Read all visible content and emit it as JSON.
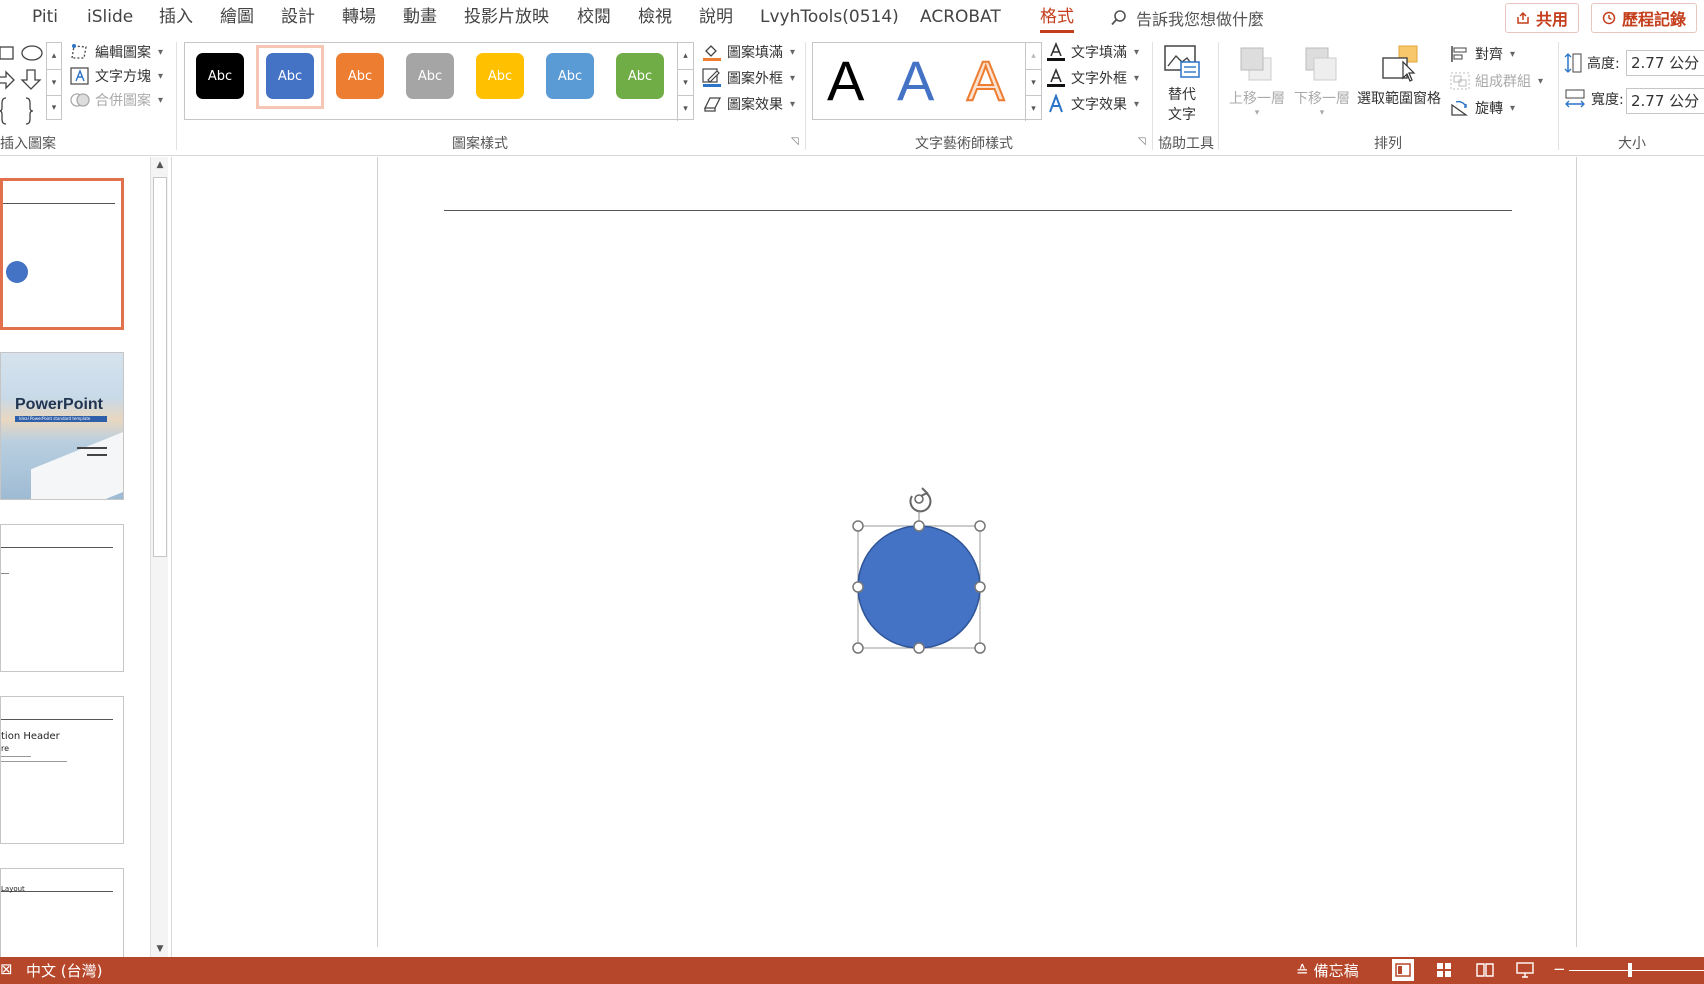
{
  "tabs": [
    {
      "label": "Piti"
    },
    {
      "label": "iSlide"
    },
    {
      "label": "插入"
    },
    {
      "label": "繪圖"
    },
    {
      "label": "設計"
    },
    {
      "label": "轉場"
    },
    {
      "label": "動畫"
    },
    {
      "label": "投影片放映"
    },
    {
      "label": "校閱"
    },
    {
      "label": "檢視"
    },
    {
      "label": "說明"
    },
    {
      "label": "LvyhTools(0514)"
    },
    {
      "label": "ACROBAT"
    },
    {
      "label": "格式"
    }
  ],
  "tab_partial": "",
  "tell_me": "告訴我您想做什麼",
  "share_button": "共用",
  "history_button": "歷程記錄",
  "ribbon": {
    "insert_shapes": {
      "label": "插入圖案",
      "edit_shape": "編輯圖案",
      "text_box": "文字方塊",
      "merge_shapes": "合併圖案"
    },
    "shape_styles": {
      "label": "圖案樣式",
      "swatches": [
        {
          "text": "Abc",
          "color": "#000000",
          "text_color": "#ffffff"
        },
        {
          "text": "Abc",
          "color": "#4472c4",
          "text_color": "#ffffff"
        },
        {
          "text": "Abc",
          "color": "#ed7d31",
          "text_color": "#ffffff"
        },
        {
          "text": "Abc",
          "color": "#a5a5a5",
          "text_color": "#ffffff"
        },
        {
          "text": "Abc",
          "color": "#ffc000",
          "text_color": "#ffffff"
        },
        {
          "text": "Abc",
          "color": "#5b9bd5",
          "text_color": "#ffffff"
        },
        {
          "text": "Abc",
          "color": "#70ad47",
          "text_color": "#ffffff"
        }
      ],
      "shape_fill": "圖案填滿",
      "shape_outline": "圖案外框",
      "shape_effects": "圖案效果"
    },
    "wordart_styles": {
      "label": "文字藝術師樣式",
      "letters": [
        {
          "text": "A",
          "color": "#000000"
        },
        {
          "text": "A",
          "color": "#4472c4"
        },
        {
          "text": "A",
          "color": "#ed7d31"
        }
      ],
      "text_fill": "文字填滿",
      "text_outline": "文字外框",
      "text_effects": "文字效果"
    },
    "accessibility": {
      "label": "協助工具",
      "alt_text_line1": "替代",
      "alt_text_line2": "文字"
    },
    "arrange": {
      "label": "排列",
      "bring_forward": "上移一層",
      "send_backward": "下移一層",
      "selection_pane": "選取範圍窗格",
      "align": "對齊",
      "group": "組成群組",
      "rotate": "旋轉"
    },
    "size": {
      "label": "大小",
      "height_label": "高度:",
      "height_value": "2.77 公分",
      "width_label": "寬度:",
      "width_value": "2.77 公分"
    }
  },
  "thumbnails": {
    "slide2_title": "PowerPoint",
    "slide2_subtitle": "Ideal PowerPoint standard template",
    "slide4_title": "tion Header",
    "slide4_line": "re",
    "slide5_text": "Layout"
  },
  "status": {
    "language": "中文 (台灣)",
    "notes": "備忘稿"
  },
  "colors": {
    "accent": "#c43e1c",
    "status_bar": "#b7472a",
    "shape_fill": "#4472c4"
  }
}
